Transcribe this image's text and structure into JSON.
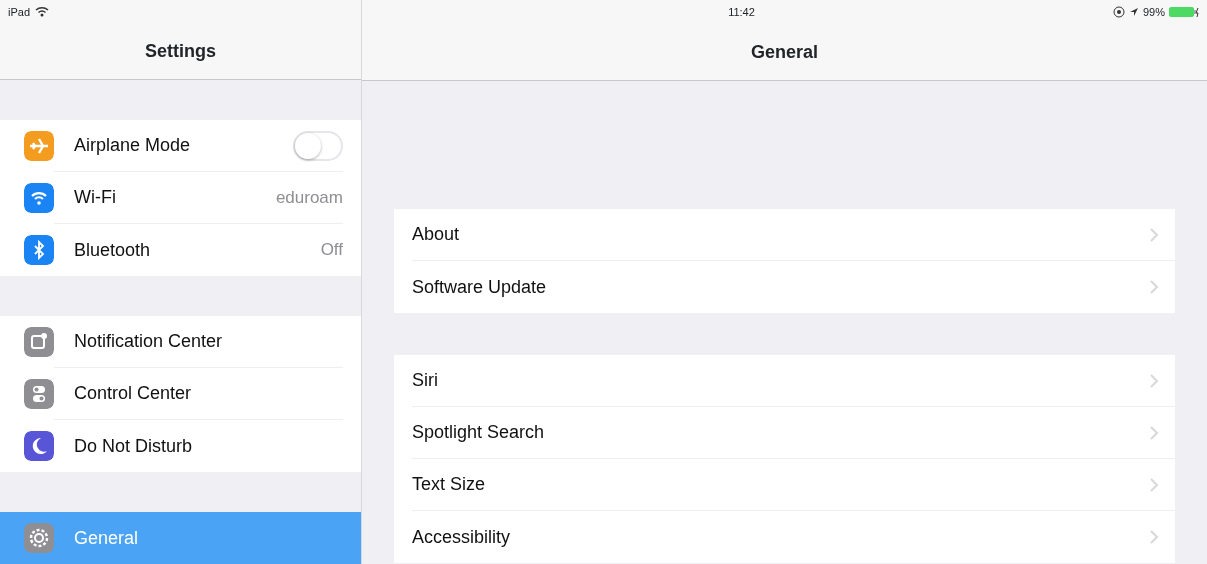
{
  "status_bar": {
    "device": "iPad",
    "time": "11:42",
    "battery": "99%"
  },
  "sidebar": {
    "title": "Settings",
    "groups": [
      [
        {
          "label": "Airplane Mode",
          "kind": "toggle",
          "on": false,
          "color": "#f39c1f",
          "selected": false
        },
        {
          "label": "Wi-Fi",
          "kind": "value",
          "value": "eduroam",
          "color": "#1a84f5",
          "selected": false
        },
        {
          "label": "Bluetooth",
          "kind": "value",
          "value": "Off",
          "color": "#1a84f5",
          "selected": false
        }
      ],
      [
        {
          "label": "Notification Center",
          "kind": "link",
          "color": "#8e8e93",
          "selected": false
        },
        {
          "label": "Control Center",
          "kind": "link",
          "color": "#8e8e93",
          "selected": false
        },
        {
          "label": "Do Not Disturb",
          "kind": "link",
          "color": "#5856d6",
          "selected": false
        }
      ],
      [
        {
          "label": "General",
          "kind": "link",
          "color": "#8e8e93",
          "selected": true
        }
      ]
    ]
  },
  "detail": {
    "title": "General",
    "groups": [
      [
        "About",
        "Software Update"
      ],
      [
        "Siri",
        "Spotlight Search",
        "Text Size",
        "Accessibility"
      ]
    ]
  }
}
